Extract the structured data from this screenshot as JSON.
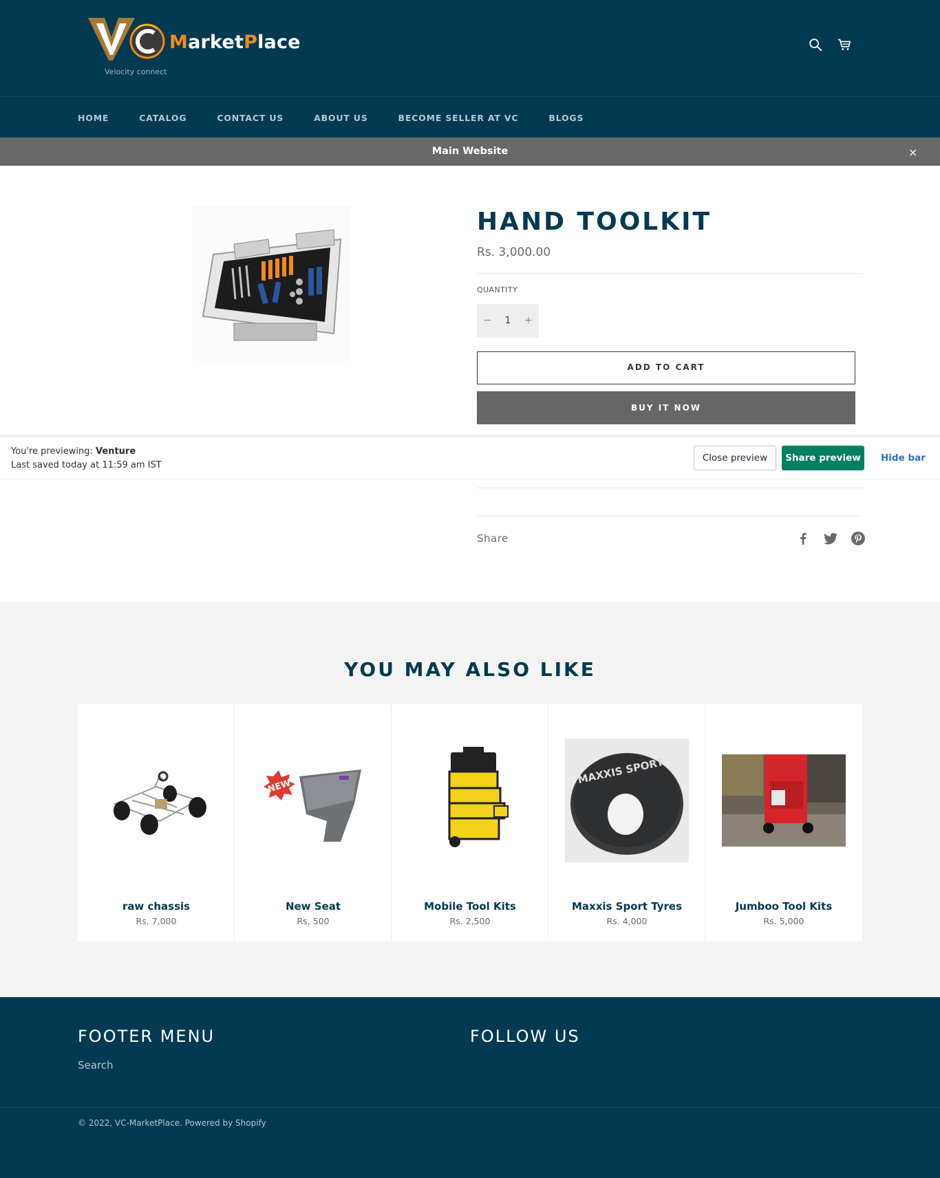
{
  "header": {
    "logo_text_a": "M",
    "logo_text_b": "arket",
    "logo_text_c": "P",
    "logo_text_d": "lace",
    "logo_tagline": "Velocity connect",
    "icons": [
      "search-icon",
      "cart-icon"
    ]
  },
  "nav": {
    "items": [
      {
        "label": "HOME"
      },
      {
        "label": "CATALOG"
      },
      {
        "label": "CONTACT US"
      },
      {
        "label": "ABOUT US"
      },
      {
        "label": "BECOME SELLER AT VC"
      },
      {
        "label": "BLOGS"
      }
    ]
  },
  "announcement": {
    "text": "Main Website",
    "close": "×"
  },
  "product": {
    "title": "HAND TOOLKIT",
    "price": "Rs. 3,000.00",
    "quantity_label": "QUANTITY",
    "quantity_minus": "−",
    "quantity_value": "1",
    "quantity_plus": "+",
    "add_to_cart": "ADD TO CART",
    "buy_now": "BUY IT NOW",
    "share_label": "Share",
    "share_icons": [
      "facebook-icon",
      "twitter-icon",
      "pinterest-icon"
    ]
  },
  "preview_bar": {
    "previewing_prefix": "You're previewing: ",
    "theme_name": "Venture",
    "last_saved": "Last saved today at 11:59 am IST",
    "close_preview": "Close preview",
    "share_preview": "Share preview",
    "hide_bar": "Hide bar"
  },
  "related": {
    "title": "YOU MAY ALSO LIKE",
    "items": [
      {
        "name": "raw chassis",
        "price": "Rs. 7,000"
      },
      {
        "name": "New Seat",
        "price": "Rs. 500",
        "badge": "NEW"
      },
      {
        "name": "Mobile Tool Kits",
        "price": "Rs. 2,500"
      },
      {
        "name": "Maxxis Sport Tyres",
        "price": "Rs. 4,000",
        "tyre_text": "MAXXIS SPORT"
      },
      {
        "name": "Jumboo Tool Kits",
        "price": "Rs. 5,000"
      }
    ]
  },
  "footer": {
    "menu_title": "FOOTER MENU",
    "follow_title": "FOLLOW US",
    "search_link": "Search",
    "copyright": "© 2022, ",
    "shop_link": "VC-MarketPlace",
    "powered": ". Powered by Shopify"
  },
  "colors": {
    "brand_navy": "#023a51",
    "logo_orange": "#f08a1c",
    "announce_gray": "#686868",
    "buy_button": "#666666",
    "share_preview_green": "#008060",
    "hide_bar_link": "#2c6ecb"
  }
}
